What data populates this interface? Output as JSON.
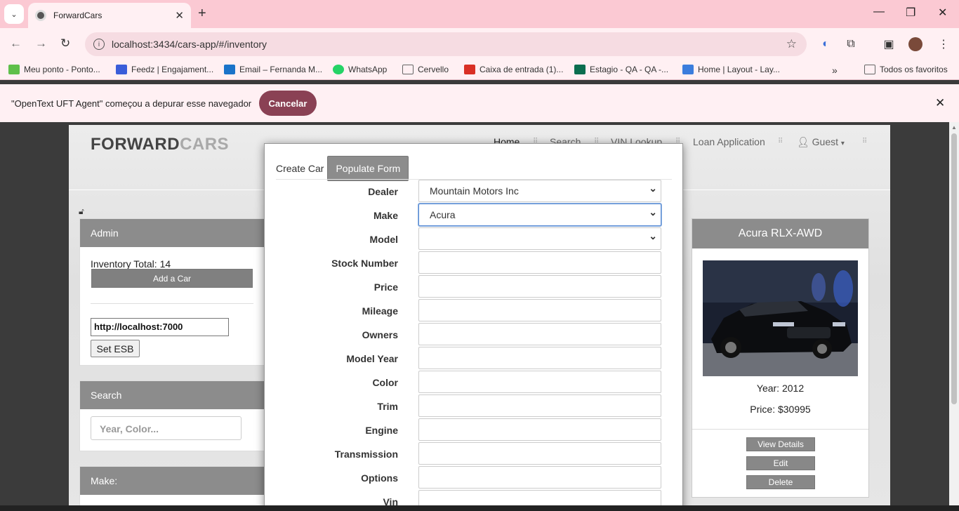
{
  "browser": {
    "tab_title": "ForwardCars",
    "url": "localhost:3434/cars-app/#/inventory",
    "bookmarks": [
      {
        "label": "Meu ponto - Ponto...",
        "color": "#5fbf4a"
      },
      {
        "label": "Feedz | Engajament...",
        "color": "#3a5dd9"
      },
      {
        "label": "Email – Fernanda M...",
        "color": "#1a73c9"
      },
      {
        "label": "WhatsApp",
        "color": "#25d366"
      },
      {
        "label": "Cervello",
        "color": "#666666"
      },
      {
        "label": "Caixa de entrada (1)...",
        "color": "#d93025"
      },
      {
        "label": "Estagio - QA - QA -...",
        "color": "#0b6e4f"
      },
      {
        "label": "Home | Layout - Lay...",
        "color": "#3b7ddd"
      }
    ],
    "all_bookmarks": "Todos os favoritos",
    "infobar_message": "\"OpenText UFT Agent\" começou a depurar esse navegador",
    "infobar_cancel": "Cancelar"
  },
  "site": {
    "brand_forward": "FORWARD",
    "brand_cars": "CARS",
    "nav": [
      "Home",
      "Search",
      "VIN Lookup",
      "Loan Application",
      "Guest"
    ]
  },
  "admin": {
    "title": "Admin",
    "inventory_total": "Inventory Total: 14",
    "add_car": "Add a Car",
    "esb_url": "http://localhost:7000",
    "set_esb": "Set ESB"
  },
  "search": {
    "title": "Search",
    "placeholder": "Year, Color..."
  },
  "make_panel": {
    "title": "Make:"
  },
  "car_card": {
    "title": "Acura RLX-AWD",
    "year": "Year: 2012",
    "price": "Price: $30995",
    "view_details": "View Details",
    "edit": "Edit",
    "delete": "Delete"
  },
  "modal": {
    "tab_create": "Create Car",
    "tab_populate": "Populate Form",
    "fields": [
      {
        "label": "Dealer",
        "value": "Mountain Motors Inc",
        "type": "select"
      },
      {
        "label": "Make",
        "value": "Acura",
        "type": "select"
      },
      {
        "label": "Model",
        "value": "",
        "type": "select"
      },
      {
        "label": "Stock Number",
        "value": "",
        "type": "text"
      },
      {
        "label": "Price",
        "value": "",
        "type": "text"
      },
      {
        "label": "Mileage",
        "value": "",
        "type": "text"
      },
      {
        "label": "Owners",
        "value": "",
        "type": "text"
      },
      {
        "label": "Model Year",
        "value": "",
        "type": "text"
      },
      {
        "label": "Color",
        "value": "",
        "type": "text"
      },
      {
        "label": "Trim",
        "value": "",
        "type": "text"
      },
      {
        "label": "Engine",
        "value": "",
        "type": "text"
      },
      {
        "label": "Transmission",
        "value": "",
        "type": "text"
      },
      {
        "label": "Options",
        "value": "",
        "type": "text"
      },
      {
        "label": "Vin",
        "value": "",
        "type": "text"
      }
    ]
  }
}
